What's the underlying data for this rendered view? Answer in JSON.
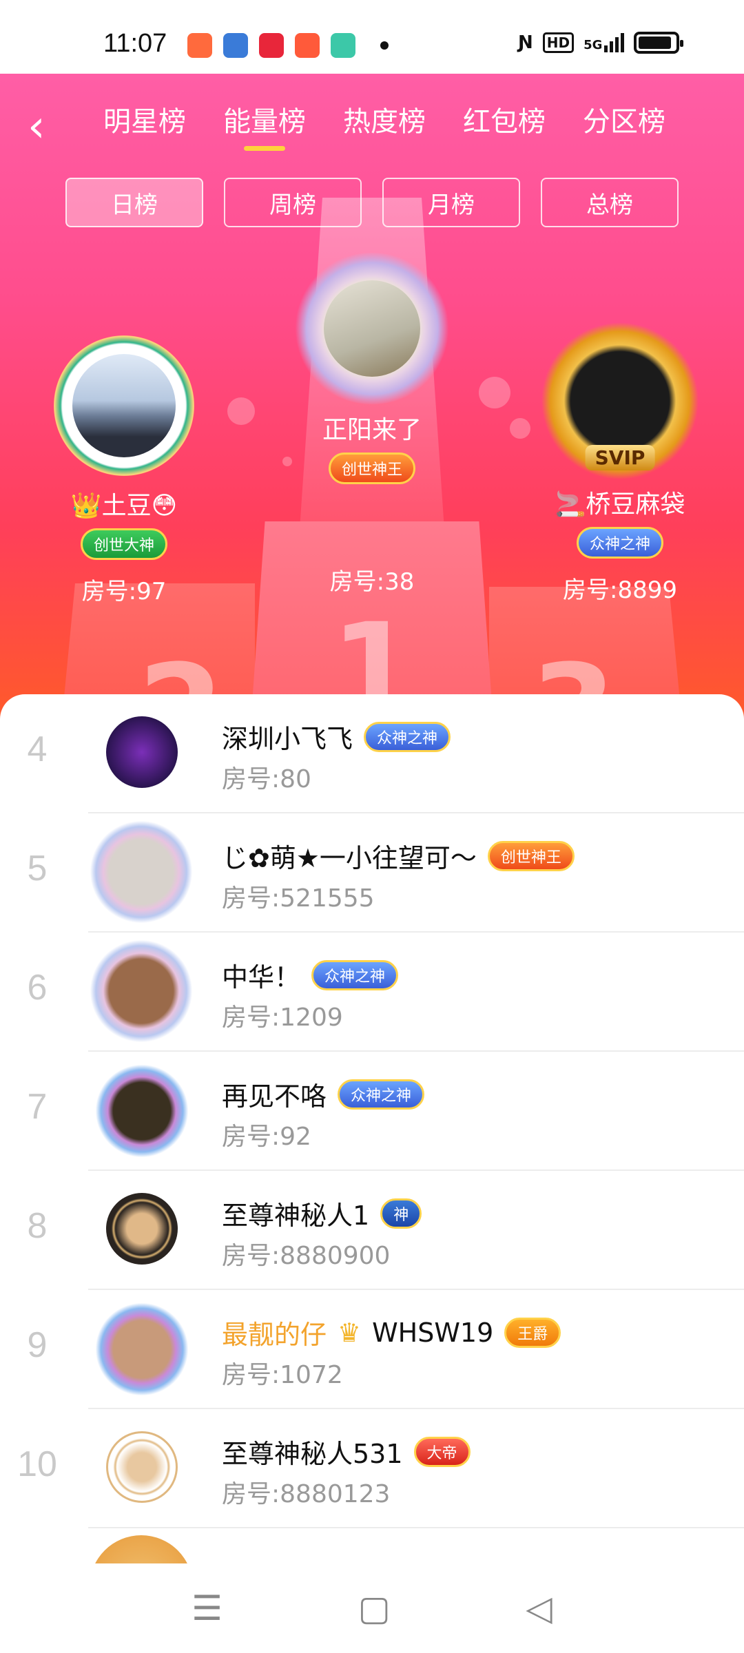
{
  "status_bar": {
    "time": "11:07",
    "app_icon_colors": [
      "#ff6a3d",
      "#3a7bd8",
      "#e8263a",
      "#ff5a3a",
      "#3cc8a8"
    ],
    "sys_icons": [
      "nfc-icon",
      "hd-icon",
      "signal-5g-icon",
      "battery-icon"
    ],
    "hd_label": "HD",
    "net_label": "5G",
    "battery_level": 0.9
  },
  "header": {
    "tabs": [
      {
        "label": "明星榜",
        "active": false
      },
      {
        "label": "能量榜",
        "active": true
      },
      {
        "label": "热度榜",
        "active": false
      },
      {
        "label": "红包榜",
        "active": false
      },
      {
        "label": "分区榜",
        "active": false
      }
    ],
    "subtabs": [
      {
        "label": "日榜",
        "active": true
      },
      {
        "label": "周榜",
        "active": false
      },
      {
        "label": "月榜",
        "active": false
      },
      {
        "label": "总榜",
        "active": false
      }
    ]
  },
  "podium": {
    "first": {
      "rank": "1",
      "name": "正阳来了",
      "badge": "创世神王",
      "room": "房号:38"
    },
    "second": {
      "rank": "2",
      "name": "👑土豆😳",
      "badge": "创世大神",
      "room": "房号:97"
    },
    "third": {
      "rank": "3",
      "name": "🚬桥豆麻袋",
      "badge": "众神之神",
      "frame_label": "SVIP",
      "room": "房号:8899"
    }
  },
  "list": [
    {
      "rank": "4",
      "name": "深圳小飞飞",
      "badge": "众神之神",
      "badge_color": "blue",
      "room": "房号:80"
    },
    {
      "rank": "5",
      "name": "じ✿萌★一小往望可～",
      "badge": "创世神王",
      "badge_color": "orange",
      "room": "房号:521555"
    },
    {
      "rank": "6",
      "name": "中华！",
      "badge": "众神之神",
      "badge_color": "blue",
      "room": "房号:1209"
    },
    {
      "rank": "7",
      "name": "再见不咯",
      "badge": "众神之神",
      "badge_color": "blue",
      "room": "房号:92"
    },
    {
      "rank": "8",
      "name": "至尊神秘人1",
      "badge": "神",
      "badge_color": "darkblue",
      "room": "房号:8880900"
    },
    {
      "rank": "9",
      "name_prefix": "最靓的仔",
      "name": "WHSW19",
      "badge": "王爵",
      "badge_color": "gold",
      "room": "房号:1072"
    },
    {
      "rank": "10",
      "name": "至尊神秘人531",
      "badge": "大帝",
      "badge_color": "red",
      "room": "房号:8880123"
    }
  ],
  "nav": {
    "icons": [
      "menu-icon",
      "home-icon",
      "back-icon"
    ],
    "menu_glyph": "☰",
    "home_glyph": "▢",
    "back_glyph": "◁"
  }
}
